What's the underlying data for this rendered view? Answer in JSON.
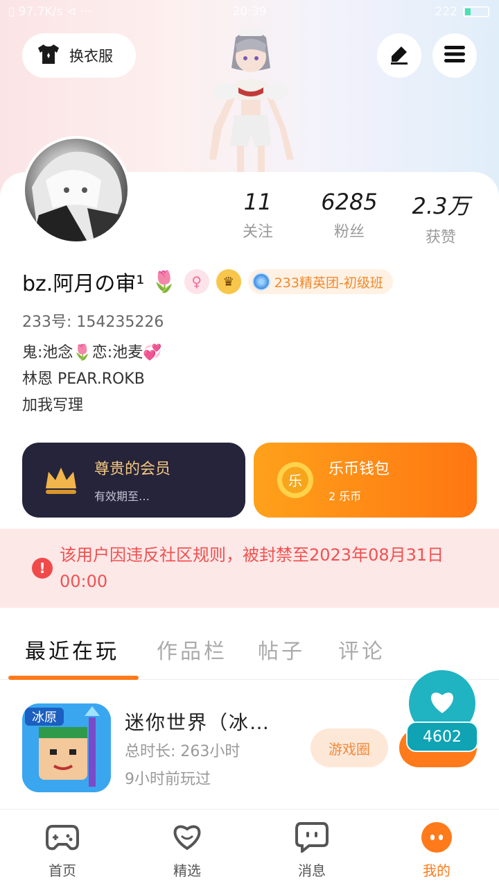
{
  "status_bar": {
    "left": "▯ 97.7K/s ⊲ ···",
    "time": "20:39",
    "battery": "222"
  },
  "top_actions": {
    "wardrobe_label": "换衣服"
  },
  "stats": [
    {
      "value": "11",
      "label": "关注"
    },
    {
      "value": "6285",
      "label": "粉丝"
    },
    {
      "value": "2.3万",
      "label": "获赞"
    }
  ],
  "profile": {
    "name": "bz.阿月の审¹",
    "tulip": "🌷",
    "gender_symbol": "♀",
    "crown_symbol": "♛",
    "team_badge": "233精英团-初级班",
    "uid": "233号: 154235226",
    "bio_lines": [
      "鬼:池念🌷恋:池麦💞",
      "林恩 PEAR.ROKB",
      "加我写理"
    ]
  },
  "vip_card": {
    "title": "尊贵的会员",
    "subtitle": "有效期至…"
  },
  "coin_card": {
    "title": "乐币钱包",
    "subtitle": "2 乐币",
    "icon_text": "乐"
  },
  "warning": {
    "icon": "!",
    "text": "该用户因违反社区规则，被封禁至2023年08月31日 00:00"
  },
  "tabs": [
    "最近在玩",
    "作品栏",
    "帖子",
    "评论"
  ],
  "recent_game": {
    "title": "迷你世界（冰…",
    "total_time": "总时长: 263小时",
    "last_played": "9小时前玩过",
    "circle_button": "游戏圈",
    "icon_text": "冰原"
  },
  "like_badge": {
    "count": "4602"
  },
  "bottom_nav": [
    {
      "label": "首页",
      "active": false
    },
    {
      "label": "精选",
      "active": false
    },
    {
      "label": "消息",
      "active": false
    },
    {
      "label": "我的",
      "active": true
    }
  ],
  "colors": {
    "accent": "#ff7a1a",
    "warning": "#f0514f",
    "vip_bg": "#26243a",
    "like_teal": "#20b3c2"
  }
}
